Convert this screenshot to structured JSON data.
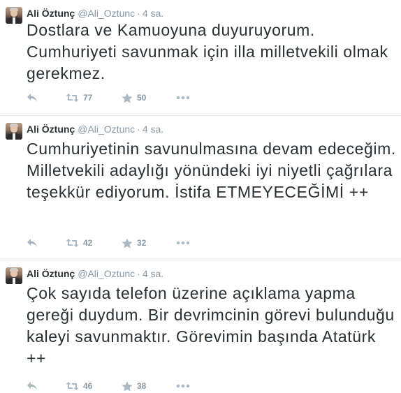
{
  "tweets": [
    {
      "name": "Ali Öztunç",
      "handle": "@Ali_Oztunc",
      "separator": "·",
      "time": "4 sa.",
      "text": "Dostlara ve Kamuoyuna duyuruyorum. Cumhuriyeti savunmak için illa milletvekili olmak gerekmez.",
      "retweets": "77",
      "favorites": "50"
    },
    {
      "name": "Ali Öztunç",
      "handle": "@Ali_Oztunc",
      "separator": "·",
      "time": "4 sa.",
      "text": "Cumhuriyetinin savunulmasına devam edeceğim. Milletvekili adaylığı yönündeki iyi niyetli çağrılara teşekkür ediyorum. İstifa ETMEYECEĞİMİ ++",
      "retweets": "42",
      "favorites": "32"
    },
    {
      "name": "Ali Öztunç",
      "handle": "@Ali_Oztunc",
      "separator": "·",
      "time": "4 sa.",
      "text": "Çok sayıda telefon üzerine açıklama yapma gereği duydum. Bir devrimcinin görevi bulunduğu kaleyi savunmaktır. Görevimin başında Atatürk ++",
      "retweets": "46",
      "favorites": "38"
    }
  ],
  "icons": {
    "reply": "reply-icon",
    "retweet": "retweet-icon",
    "favorite": "star-icon",
    "more": "more-icon"
  },
  "colors": {
    "text": "#292f33",
    "muted": "#8899a6",
    "icon": "#aab8c2",
    "divider": "#e1e8ed"
  }
}
